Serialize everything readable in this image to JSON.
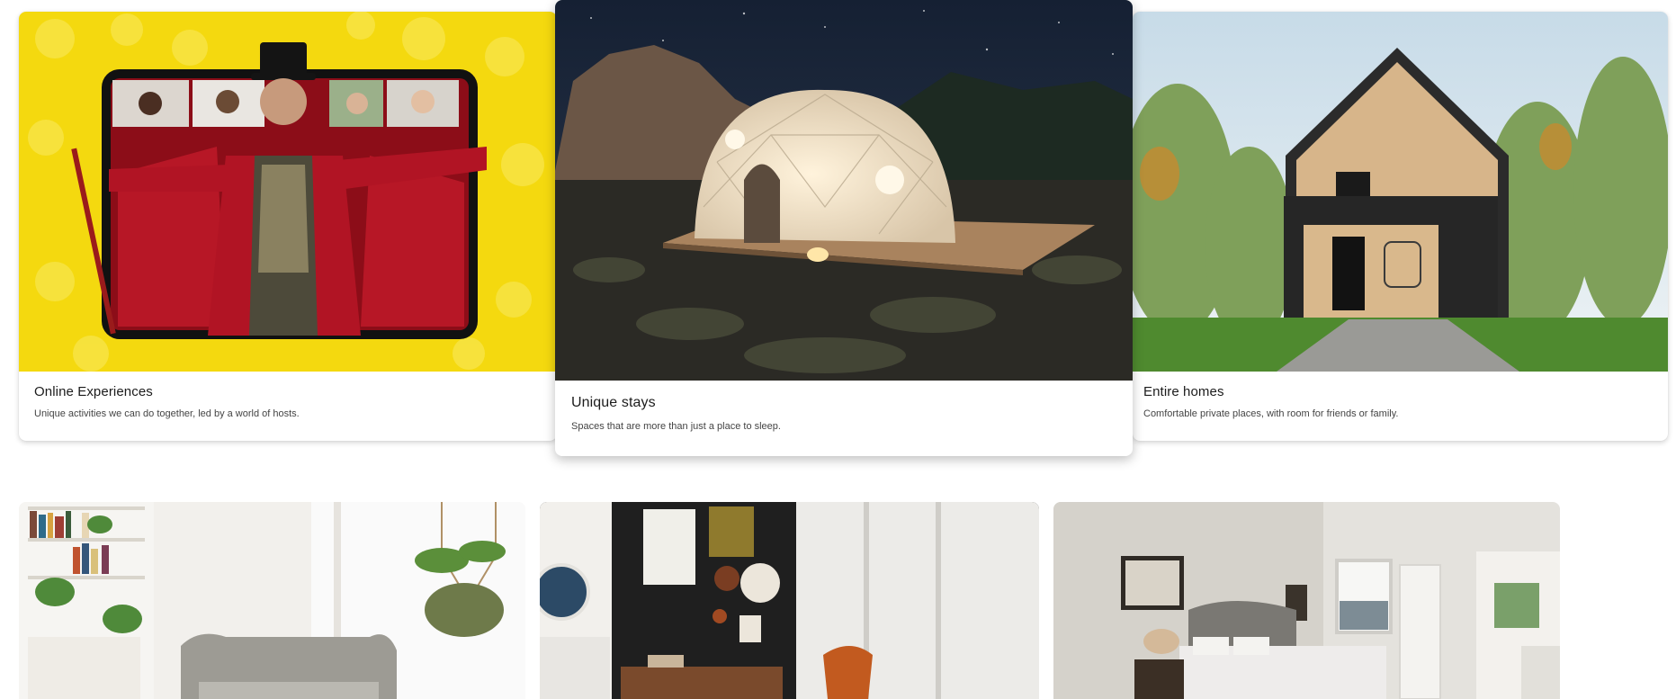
{
  "categories": [
    {
      "title": "Online Experiences",
      "description": "Unique activities we can do together, led by a world of hosts.",
      "photo_icon": "online-experiences-photo"
    },
    {
      "title": "Unique stays",
      "description": "Spaces that are more than just a place to sleep.",
      "photo_icon": "dome-tent-photo"
    },
    {
      "title": "Entire homes",
      "description": "Comfortable private places, with room for friends or family.",
      "photo_icon": "cabin-house-photo"
    }
  ],
  "rooms": [
    {
      "photo_icon": "living-room-photo"
    },
    {
      "photo_icon": "dark-wall-living-room-photo"
    },
    {
      "photo_icon": "bedroom-photo"
    }
  ],
  "colors": {
    "online_bg": "#f5dc12",
    "night_sky": "#1b2535",
    "card_text": "#1c1c1c",
    "desc_text": "#444444"
  }
}
